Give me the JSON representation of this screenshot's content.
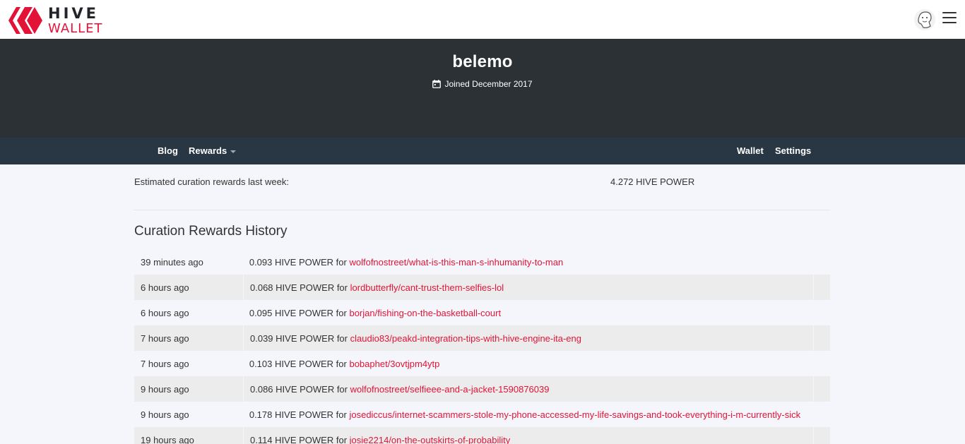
{
  "brand": {
    "line1": "HIVE",
    "line2": "WALLET"
  },
  "profile": {
    "name": "belemo",
    "joined": "Joined December 2017"
  },
  "nav": {
    "blog": "Blog",
    "rewards": "Rewards",
    "wallet": "Wallet",
    "settings": "Settings"
  },
  "estimate": {
    "label": "Estimated curation rewards last week:",
    "value": "4.272 HIVE POWER"
  },
  "history": {
    "title": "Curation Rewards History",
    "rows": [
      {
        "time": "39 minutes ago",
        "amount": "0.093 HIVE POWER for",
        "link": "wolfofnostreet/what-is-this-man-s-inhumanity-to-man"
      },
      {
        "time": "6 hours ago",
        "amount": "0.068 HIVE POWER for",
        "link": "lordbutterfly/cant-trust-them-selfies-lol"
      },
      {
        "time": "6 hours ago",
        "amount": "0.095 HIVE POWER for",
        "link": "borjan/fishing-on-the-basketball-court"
      },
      {
        "time": "7 hours ago",
        "amount": "0.039 HIVE POWER for",
        "link": "claudio83/peakd-integration-tips-with-hive-engine-ita-eng"
      },
      {
        "time": "7 hours ago",
        "amount": "0.103 HIVE POWER for",
        "link": "bobaphet/3ovtjpm4ytp"
      },
      {
        "time": "9 hours ago",
        "amount": "0.086 HIVE POWER for",
        "link": "wolfofnostreet/selfieee-and-a-jacket-1590876039"
      },
      {
        "time": "9 hours ago",
        "amount": "0.178 HIVE POWER for",
        "link": "josediccus/internet-scammers-stole-my-phone-accessed-my-life-savings-and-took-everything-i-m-currently-sick"
      },
      {
        "time": "19 hours ago",
        "amount": "0.114 HIVE POWER for",
        "link": "josie2214/on-the-outskirts-of-probability"
      }
    ]
  },
  "icons": {
    "logo": "hive-logo-icon",
    "avatar": "user-avatar-icon",
    "menu": "hamburger-menu-icon",
    "calendar": "calendar-icon",
    "caret": "caret-down-icon"
  },
  "colors": {
    "accent": "#e31337",
    "header": "#2c3136",
    "subnav": "#293745"
  }
}
